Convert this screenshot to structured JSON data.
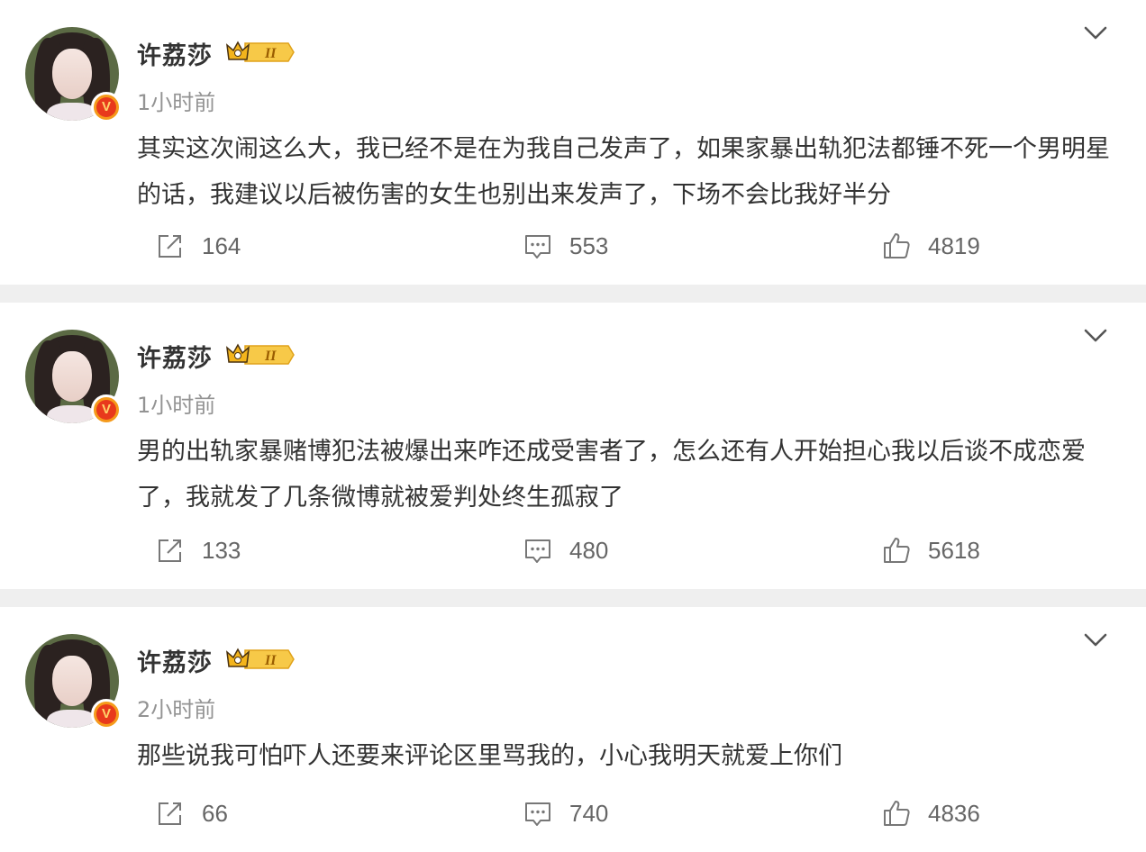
{
  "posts": [
    {
      "author": "许荔莎",
      "time": "1小时前",
      "text": "其实这次闹这么大，我已经不是在为我自己发声了，如果家暴出轨犯法都锤不死一个男明星的话，我建议以后被伤害的女生也别出来发声了，下场不会比我好半分",
      "reposts": "164",
      "comments": "553",
      "likes": "4819"
    },
    {
      "author": "许荔莎",
      "time": "1小时前",
      "text": "男的出轨家暴赌博犯法被爆出来咋还成受害者了，怎么还有人开始担心我以后谈不成恋爱了，我就发了几条微博就被爱判处终生孤寂了",
      "reposts": "133",
      "comments": "480",
      "likes": "5618"
    },
    {
      "author": "许荔莎",
      "time": "2小时前",
      "text": "那些说我可怕吓人还要来评论区里骂我的，小心我明天就爱上你们",
      "reposts": "66",
      "comments": "740",
      "likes": "4836"
    }
  ],
  "badge": {
    "verified_letter": "V",
    "level": "II"
  },
  "icons": [
    "repost-icon",
    "comment-icon",
    "like-icon",
    "chevron-down-icon",
    "crown-icon"
  ],
  "colors": {
    "verified_orange": "#f59a1b",
    "crown_gold": "#f3b41c",
    "text": "#333333",
    "muted": "#939393"
  }
}
